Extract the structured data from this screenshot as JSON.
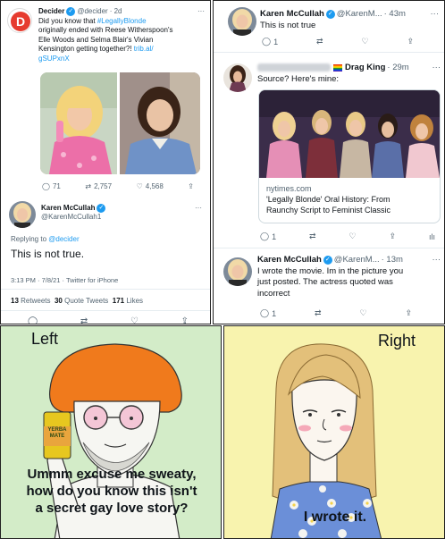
{
  "tweet1": {
    "name": "Decider",
    "handle": "@decider",
    "time": "· 2d",
    "line1": "Did you know that ",
    "hashtag": "#LegallyBlonde",
    "line2": "originally ended with Reese Witherspoon's",
    "line3": "Elle Woods and Selma Blair's Vivian",
    "line4": "Kensington getting together?!",
    "link": "trib.al/",
    "link2": "gSUPxnX",
    "replies": "71",
    "retweets": "2,757",
    "likes": "4,568"
  },
  "tweet2": {
    "name": "Karen McCullah",
    "handle": "@KarenMcCullah1",
    "reply_to_label": "Replying to ",
    "reply_to": "@decider",
    "text": "This is not true.",
    "timestamp": "3:13 PM · 7/8/21 · Twitter for iPhone",
    "retweets_n": "13",
    "retweets_l": "Retweets",
    "quotes_n": "30",
    "quotes_l": "Quote Tweets",
    "likes_n": "171",
    "likes_l": "Likes"
  },
  "tweet3": {
    "name": "Karen McCullah",
    "handle": "@KarenM...",
    "time": "· 43m",
    "text": "This is not true",
    "replies": "1"
  },
  "tweet4": {
    "name": "Drag King",
    "time": "· 29m",
    "text": "Source? Here's mine:",
    "card_domain": "nytimes.com",
    "card_title1": "'Legally Blonde' Oral History: From",
    "card_title2": "Raunchy Script to Feminist Classic",
    "replies": "1"
  },
  "tweet5": {
    "name": "Karen McCullah",
    "handle": "@KarenM...",
    "time": "· 13m",
    "line1": "I wrote the movie. Im in the picture you",
    "line2": "just posted. The actress quoted was",
    "line3": "incorrect",
    "replies": "1"
  },
  "meme": {
    "left_title": "Left",
    "right_title": "Right",
    "left_line1": "Ummm excuse me sweaty,",
    "left_line2": "how do you know this isn't",
    "left_line3": "a secret gay love story?",
    "right_text": "I wrote it.",
    "can_line1": "YERBA",
    "can_line2": "MATE",
    "left_bg": "#d3ecc8",
    "right_bg": "#f8f3ae",
    "hair": "#f07a1c"
  }
}
